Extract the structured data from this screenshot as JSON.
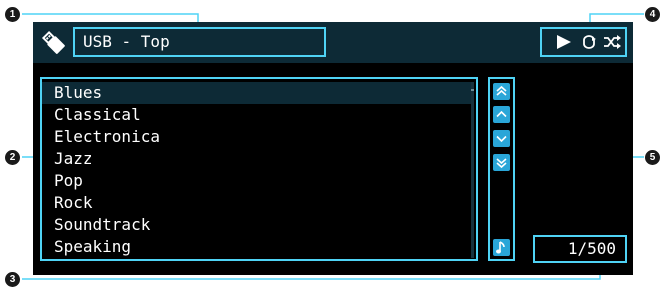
{
  "header": {
    "title": "USB - Top"
  },
  "controls": {
    "play_icon": "play-icon",
    "repeat_icon": "repeat-icon",
    "shuffle_icon": "shuffle-icon"
  },
  "list": {
    "items": [
      {
        "label": "Blues",
        "selected": true
      },
      {
        "label": "Classical"
      },
      {
        "label": "Electronica"
      },
      {
        "label": "Jazz"
      },
      {
        "label": "Pop"
      },
      {
        "label": "Rock"
      },
      {
        "label": "Soundtrack"
      },
      {
        "label": "Speaking"
      }
    ]
  },
  "nav": {
    "buttons": [
      "page-up-icon",
      "line-up-icon",
      "line-down-icon",
      "page-down-icon"
    ],
    "music_icon": "music-note-icon"
  },
  "pagination": {
    "text": "1/500"
  },
  "callouts": [
    "1",
    "2",
    "3",
    "4",
    "5"
  ],
  "colors": {
    "frame": "#4fd3f5",
    "header_bg": "#0d2a36",
    "button_bg": "#2aa6d8",
    "screen_bg": "#000000"
  }
}
